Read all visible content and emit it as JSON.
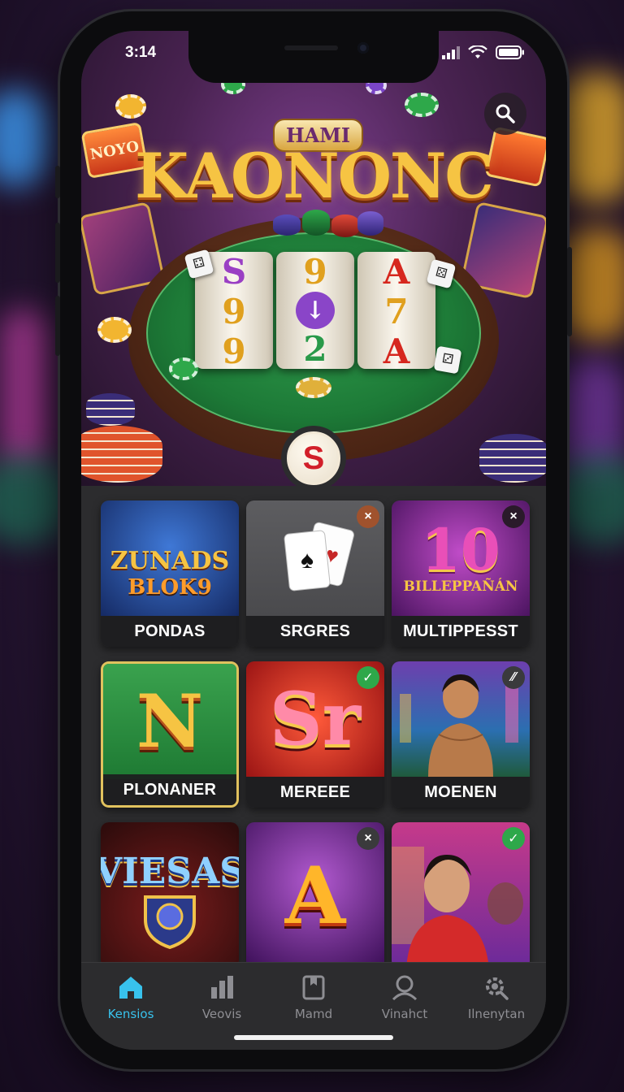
{
  "status_bar": {
    "time": "3:14"
  },
  "hero": {
    "subtitle": "HAMI",
    "title": "KAONONC",
    "sign_left": "NOYO",
    "reels": [
      [
        "S",
        "9",
        "9"
      ],
      [
        "9",
        "↓",
        "2"
      ],
      [
        "A",
        "7",
        "A"
      ]
    ],
    "center_badge": "S"
  },
  "games": [
    {
      "label": "PONDAS",
      "art_line1": "ZUNADS",
      "art_line2": "BLOK9",
      "badge": ""
    },
    {
      "label": "SRGRES",
      "badge": "close"
    },
    {
      "label": "MULTIPPESST",
      "art_big": "10",
      "art_sub": "BILLEPPAÑÁN",
      "badge": "close"
    },
    {
      "label": "PLONANER",
      "art_big": "N",
      "badge": "",
      "selected": true
    },
    {
      "label": "MEREEE",
      "art_big": "Sr",
      "badge": "check"
    },
    {
      "label": "MOENEN",
      "badge": "pin"
    },
    {
      "label": "",
      "art_big": "VIESAS",
      "badge": ""
    },
    {
      "label": "",
      "art_big": "A",
      "badge": "close"
    },
    {
      "label": "",
      "badge": "check"
    }
  ],
  "tabs": [
    {
      "label": "Kensios",
      "icon": "home-icon",
      "active": true
    },
    {
      "label": "Veovis",
      "icon": "chart-icon",
      "active": false
    },
    {
      "label": "Mamd",
      "icon": "bookmark-icon",
      "active": false
    },
    {
      "label": "Vinahct",
      "icon": "profile-icon",
      "active": false
    },
    {
      "label": "Ilnenytan",
      "icon": "settings-icon",
      "active": false
    }
  ],
  "colors": {
    "accent_active_tab": "#38c2ec",
    "badge_close": "#a0522d",
    "badge_check": "#2ea84a",
    "badge_pin": "#3a3a3c"
  }
}
